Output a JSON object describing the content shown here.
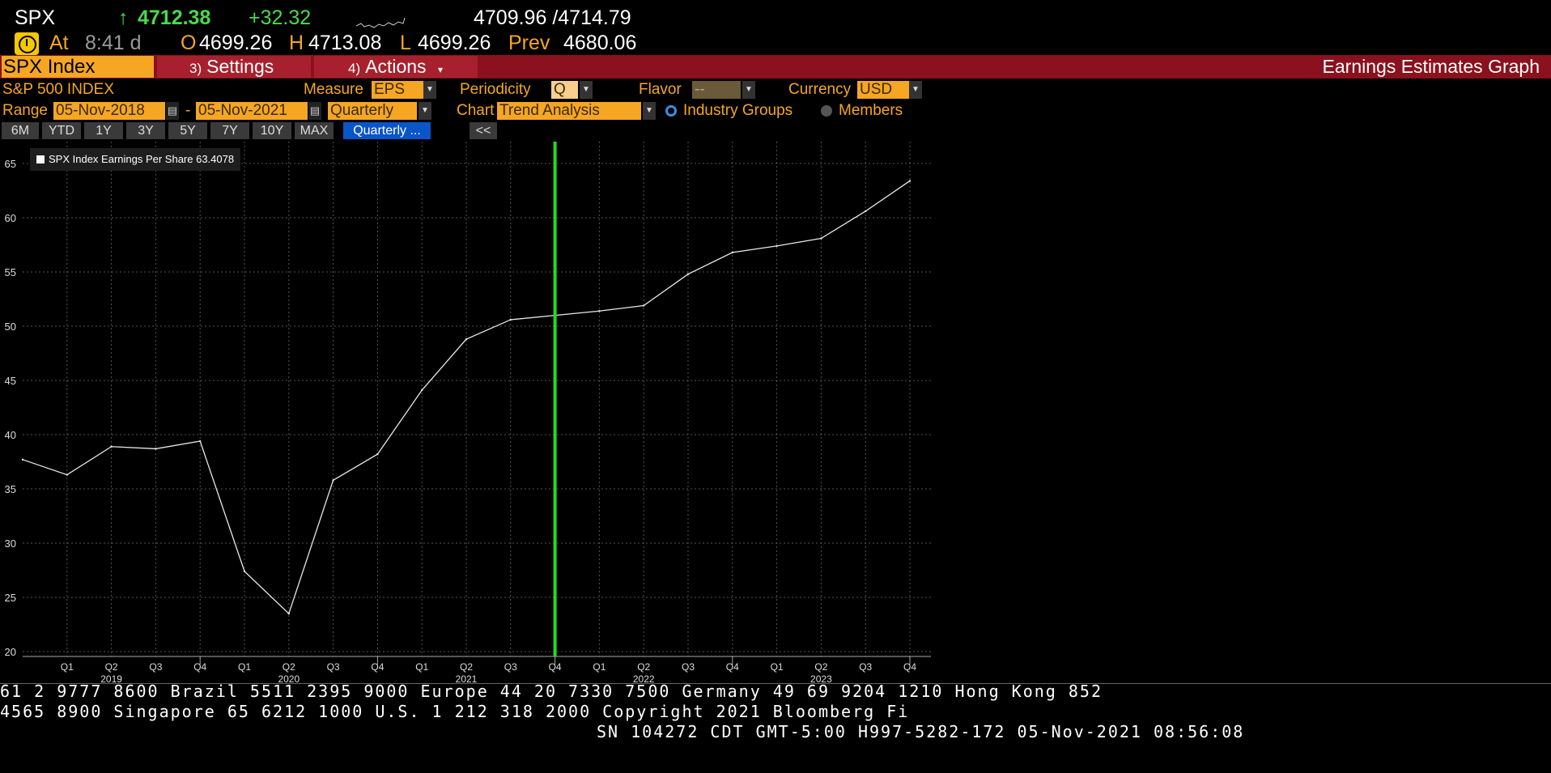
{
  "header": {
    "symbol": "SPX",
    "arrow": "↑",
    "last": "4712.38",
    "change": "+32.32",
    "bid_ask": "4709.96 /4714.79",
    "at_label": "At",
    "time": "8:41 d",
    "open_label": "O",
    "open": "4699.26",
    "high_label": "H",
    "high": "4713.08",
    "low_label": "L",
    "low": "4699.26",
    "prev_label": "Prev",
    "prev": "4680.06"
  },
  "toolbar": {
    "index_tab": "SPX Index",
    "settings_num": "3)",
    "settings_label": "Settings",
    "actions_num": "4)",
    "actions_label": "Actions",
    "actions_caret": "▾",
    "page_title": "Earnings Estimates Graph"
  },
  "controls": {
    "security_name": "S&P 500 INDEX",
    "measure_label": "Measure",
    "measure_value": "EPS",
    "periodicity_label": "Periodicity",
    "periodicity_value": "Q",
    "flavor_label": "Flavor",
    "flavor_value": "--",
    "currency_label": "Currency",
    "currency_value": "USD",
    "range_label": "Range",
    "range_start": "05-Nov-2018",
    "range_sep": "-",
    "range_end": "05-Nov-2021",
    "range_periodicity": "Quarterly",
    "chart_label": "Chart",
    "chart_value": "Trend Analysis",
    "industry_groups": "Industry Groups",
    "members": "Members",
    "collapse": "<<"
  },
  "range_buttons": [
    "6M",
    "YTD",
    "1Y",
    "3Y",
    "5Y",
    "7Y",
    "10Y",
    "MAX",
    "Quarterly ..."
  ],
  "colors": {
    "accent": "#f5a623",
    "bar": "#8a111d",
    "current_marker": "#22dd22"
  },
  "chart_data": {
    "type": "line",
    "legend": "SPX Index Earnings Per Share 63.4078",
    "x": [
      "2018 Q4",
      "2019 Q1",
      "2019 Q2",
      "2019 Q3",
      "2019 Q4",
      "2020 Q1",
      "2020 Q2",
      "2020 Q3",
      "2020 Q4",
      "2021 Q1",
      "2021 Q2",
      "2021 Q3",
      "2021 Q4",
      "2022 Q1",
      "2022 Q2",
      "2022 Q3",
      "2022 Q4",
      "2023 Q1",
      "2023 Q2",
      "2023 Q3",
      "2023 Q4"
    ],
    "series": [
      {
        "name": "SPX Index Earnings Per Share",
        "values": [
          37.7,
          36.3,
          38.9,
          38.7,
          39.4,
          27.4,
          23.5,
          35.8,
          38.2,
          44.1,
          48.8,
          50.6,
          51.0,
          51.4,
          51.9,
          54.8,
          56.8,
          57.4,
          58.1,
          60.6,
          63.4
        ]
      }
    ],
    "quarter_ticks": [
      "Q1",
      "Q2",
      "Q3",
      "Q4",
      "Q1",
      "Q2",
      "Q3",
      "Q4",
      "Q1",
      "Q2",
      "Q3",
      "Q4",
      "Q1",
      "Q2",
      "Q3",
      "Q4",
      "Q1",
      "Q2",
      "Q3",
      "Q4"
    ],
    "year_labels": [
      "2019",
      "2020",
      "2021",
      "2022",
      "2023"
    ],
    "yticks": [
      20,
      25,
      30,
      35,
      40,
      45,
      50,
      55,
      60,
      65
    ],
    "ylim": [
      19.5,
      67.5
    ],
    "current_period": "2021 Q4",
    "grid": true
  },
  "ticker": {
    "line1": "61 2 9777 8600 Brazil 5511 2395 9000 Europe 44 20 7330 7500 Germany 49 69 9204 1210 Hong Kong 852",
    "line2": " 4565 8900       Singapore 65 6212 1000       U.S. 1 212 318 2000          Copyright 2021 Bloomberg Fi",
    "line3": "SN 104272 CDT  GMT-5:00 H997-5282-172 05-Nov-2021 08:56:08"
  }
}
